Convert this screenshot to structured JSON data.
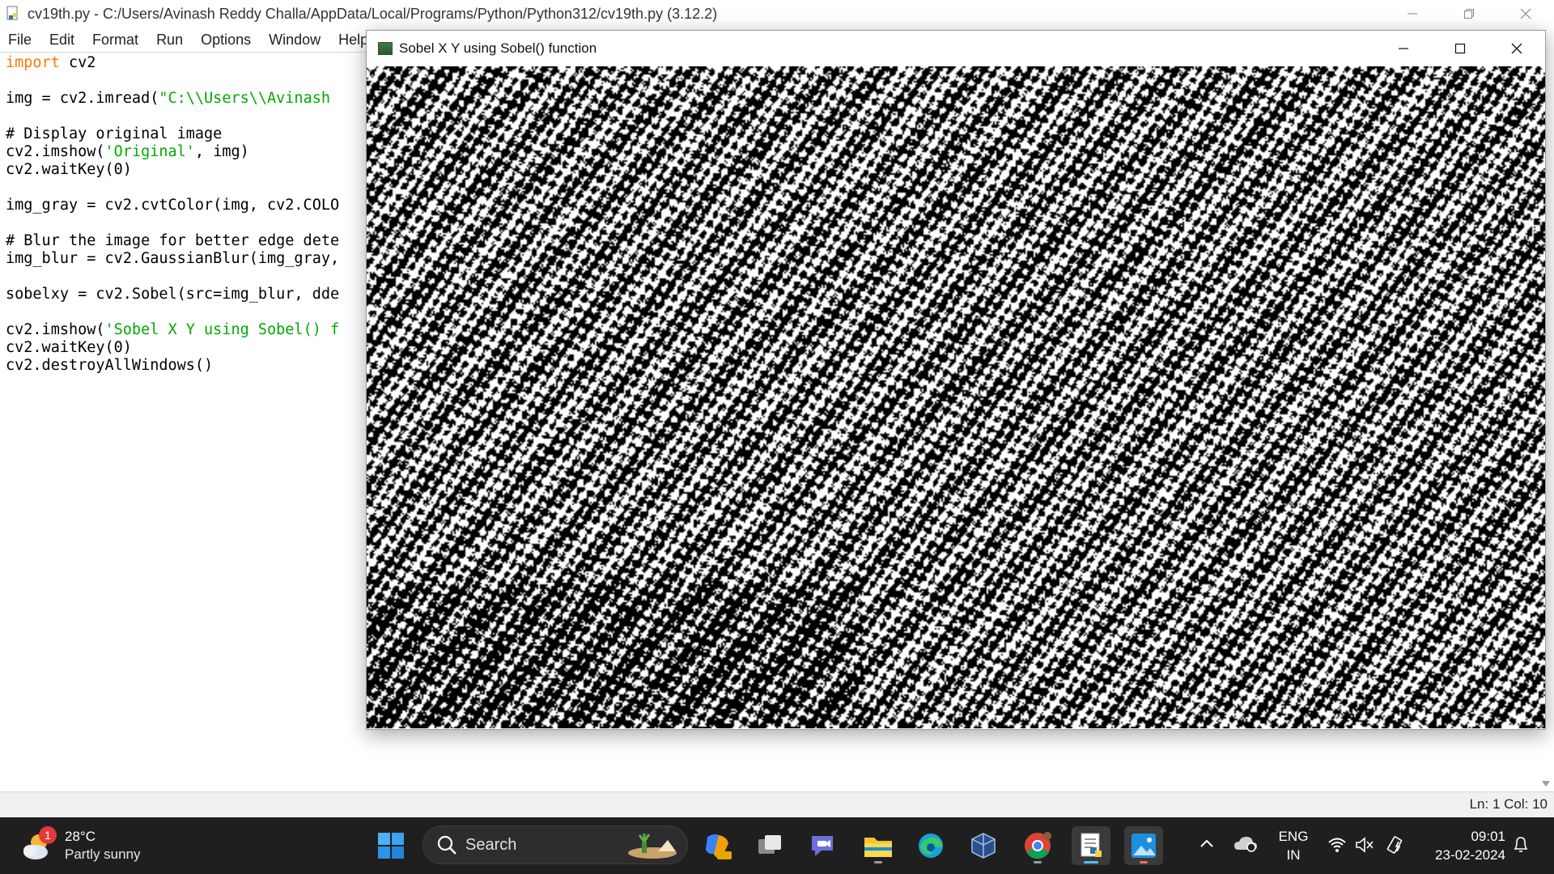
{
  "idle": {
    "title": "cv19th.py - C:/Users/Avinash Reddy Challa/AppData/Local/Programs/Python/Python312/cv19th.py (3.12.2)",
    "menu": [
      "File",
      "Edit",
      "Format",
      "Run",
      "Options",
      "Window",
      "Help"
    ],
    "code": {
      "l1_kw": "import",
      "l1_rest": " cv2",
      "l3_pre": "img = cv2.imread(",
      "l3_str": "\"C:\\\\Users\\\\Avinash",
      "l5_com": "# Display original image",
      "l6_pre": "cv2.imshow(",
      "l6_str": "'Original'",
      "l6_rest": ", img)",
      "l7": "cv2.waitKey(0)",
      "l9": "img_gray = cv2.cvtColor(img, cv2.COLO",
      "l11_com": "# Blur the image for better edge dete",
      "l12": "img_blur = cv2.GaussianBlur(img_gray,",
      "l14": "sobelxy = cv2.Sobel(src=img_blur, dde",
      "l16_pre": "cv2.imshow(",
      "l16_str": "'Sobel X Y using Sobel() f",
      "l17": "cv2.waitKey(0)",
      "l18": "cv2.destroyAllWindows()"
    },
    "status": "Ln: 1   Col: 10"
  },
  "cv_window": {
    "title": "Sobel X Y using Sobel() function"
  },
  "taskbar": {
    "weather_temp": "28°C",
    "weather_desc": "Partly sunny",
    "weather_badge": "1",
    "search_label": "Search",
    "lang_top": "ENG",
    "lang_bottom": "IN",
    "time": "09:01",
    "date": "23-02-2024"
  },
  "colors": {
    "keyword": "#ff7700",
    "string": "#00aa00",
    "comment": "#dd0000",
    "taskbar": "#1f1f1f"
  }
}
